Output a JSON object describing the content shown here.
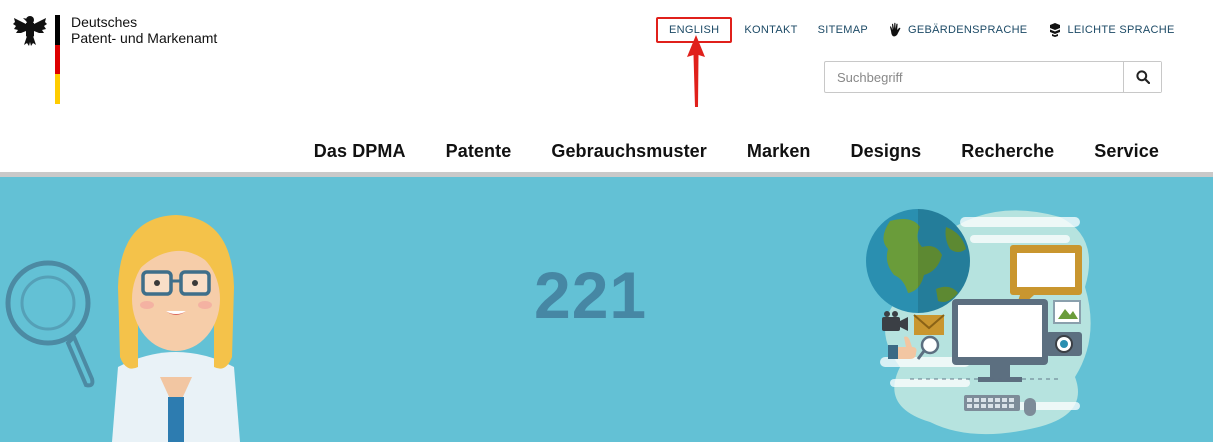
{
  "logo": {
    "line1": "Deutsches",
    "line2": "Patent- und Markenamt",
    "flag_colors": [
      "#000000",
      "#dd0000",
      "#ffcc00"
    ]
  },
  "utility_nav": [
    {
      "label": "ENGLISH",
      "icon": null
    },
    {
      "label": "KONTAKT",
      "icon": null
    },
    {
      "label": "SITEMAP",
      "icon": null
    },
    {
      "label": "GEBÄRDENSPRACHE",
      "icon": "hand-icon"
    },
    {
      "label": "LEICHTE SPRACHE",
      "icon": "easy-language-icon"
    }
  ],
  "search": {
    "placeholder": "Suchbegriff",
    "button_icon": "search-icon"
  },
  "main_nav": [
    {
      "label": "Das DPMA"
    },
    {
      "label": "Patente"
    },
    {
      "label": "Gebrauchsmuster"
    },
    {
      "label": "Marken"
    },
    {
      "label": "Designs"
    },
    {
      "label": "Recherche"
    },
    {
      "label": "Service"
    }
  ],
  "hero": {
    "number": "221",
    "background": "#63c1d5",
    "number_color": "#4687a4"
  },
  "colors": {
    "link": "#1c4a66",
    "highlight_border": "#e0201b",
    "annotation_arrow": "#e0201b"
  }
}
